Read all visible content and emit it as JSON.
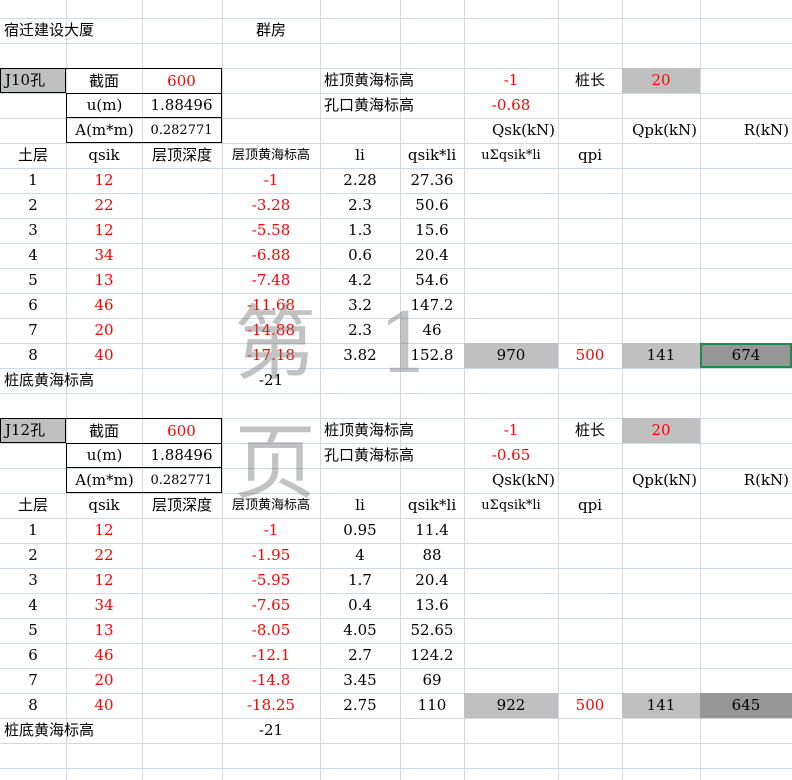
{
  "header": {
    "project": "宿迁建设大厦",
    "building": "群房"
  },
  "sections": [
    {
      "hole": "J10孔",
      "section_label": "截面",
      "section_value": "600",
      "u_label": "u(m)",
      "u_value": "1.88496",
      "a_label": "A(m*m)",
      "a_value": "0.282771",
      "pile_top_label": "桩顶黄海标高",
      "pile_top_value": "-1",
      "pile_len_label": "桩长",
      "pile_len_value": "20",
      "hole_mouth_label": "孔口黄海标高",
      "hole_mouth_value": "-0.68",
      "qsk_label": "Qsk(kN)",
      "qpk_label": "Qpk(kN)",
      "r_label": "R(kN)",
      "columns": [
        "土层",
        "qsik",
        "层顶深度",
        "层顶黄海标高",
        "li",
        "qsik*li",
        "uΣqsik*li",
        "qpi"
      ],
      "rows": [
        {
          "layer": "1",
          "qsik": "12",
          "depth": "",
          "elev": "-1",
          "li": "2.28",
          "prod": "27.36"
        },
        {
          "layer": "2",
          "qsik": "22",
          "depth": "",
          "elev": "-3.28",
          "li": "2.3",
          "prod": "50.6"
        },
        {
          "layer": "3",
          "qsik": "12",
          "depth": "",
          "elev": "-5.58",
          "li": "1.3",
          "prod": "15.6"
        },
        {
          "layer": "4",
          "qsik": "34",
          "depth": "",
          "elev": "-6.88",
          "li": "0.6",
          "prod": "20.4"
        },
        {
          "layer": "5",
          "qsik": "13",
          "depth": "",
          "elev": "-7.48",
          "li": "4.2",
          "prod": "54.6"
        },
        {
          "layer": "6",
          "qsik": "46",
          "depth": "",
          "elev": "-11.68",
          "li": "3.2",
          "prod": "147.2"
        },
        {
          "layer": "7",
          "qsik": "20",
          "depth": "",
          "elev": "-14.88",
          "li": "2.3",
          "prod": "46"
        },
        {
          "layer": "8",
          "qsik": "40",
          "depth": "",
          "elev": "-17.18",
          "li": "3.82",
          "prod": "152.8"
        }
      ],
      "sum": "970",
      "qpi": "500",
      "qpk": "141",
      "r": "674",
      "bottom_label": "桩底黄海标高",
      "bottom_value": "-21"
    },
    {
      "hole": "J12孔",
      "section_label": "截面",
      "section_value": "600",
      "u_label": "u(m)",
      "u_value": "1.88496",
      "a_label": "A(m*m)",
      "a_value": "0.282771",
      "pile_top_label": "桩顶黄海标高",
      "pile_top_value": "-1",
      "pile_len_label": "桩长",
      "pile_len_value": "20",
      "hole_mouth_label": "孔口黄海标高",
      "hole_mouth_value": "-0.65",
      "qsk_label": "Qsk(kN)",
      "qpk_label": "Qpk(kN)",
      "r_label": "R(kN)",
      "columns": [
        "土层",
        "qsik",
        "层顶深度",
        "层顶黄海标高",
        "li",
        "qsik*li",
        "uΣqsik*li",
        "qpi"
      ],
      "rows": [
        {
          "layer": "1",
          "qsik": "12",
          "depth": "",
          "elev": "-1",
          "li": "0.95",
          "prod": "11.4"
        },
        {
          "layer": "2",
          "qsik": "22",
          "depth": "",
          "elev": "-1.95",
          "li": "4",
          "prod": "88"
        },
        {
          "layer": "3",
          "qsik": "12",
          "depth": "",
          "elev": "-5.95",
          "li": "1.7",
          "prod": "20.4"
        },
        {
          "layer": "4",
          "qsik": "34",
          "depth": "",
          "elev": "-7.65",
          "li": "0.4",
          "prod": "13.6"
        },
        {
          "layer": "5",
          "qsik": "13",
          "depth": "",
          "elev": "-8.05",
          "li": "4.05",
          "prod": "52.65"
        },
        {
          "layer": "6",
          "qsik": "46",
          "depth": "",
          "elev": "-12.1",
          "li": "2.7",
          "prod": "124.2"
        },
        {
          "layer": "7",
          "qsik": "20",
          "depth": "",
          "elev": "-14.8",
          "li": "3.45",
          "prod": "69"
        },
        {
          "layer": "8",
          "qsik": "40",
          "depth": "",
          "elev": "-18.25",
          "li": "2.75",
          "prod": "110"
        }
      ],
      "sum": "922",
      "qpi": "500",
      "qpk": "141",
      "r": "645",
      "bottom_label": "桩底黄海标高",
      "bottom_value": "-21"
    }
  ],
  "watermark": "第 1 页",
  "colors": {
    "red": "#ff0000",
    "gray_fill": "#c0c0c0",
    "dark_fill": "#969696",
    "selection": "#1e8a4f",
    "gridline": "#d0d7e5"
  }
}
